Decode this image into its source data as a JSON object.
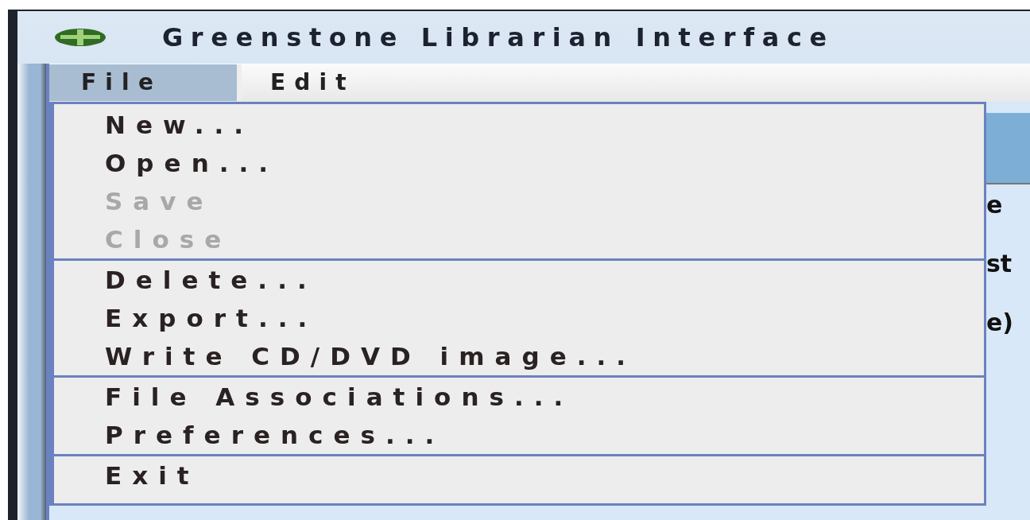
{
  "window": {
    "title": "Greenstone Librarian Interface"
  },
  "menu_bar": [
    {
      "label": "File",
      "selected": true
    },
    {
      "label": "Edit",
      "selected": false
    }
  ],
  "file_menu": [
    {
      "kind": "item",
      "label": "New...",
      "disabled": false
    },
    {
      "kind": "item",
      "label": "Open...",
      "disabled": false
    },
    {
      "kind": "item",
      "label": "Save",
      "disabled": true
    },
    {
      "kind": "item",
      "label": "Close",
      "disabled": true
    },
    {
      "kind": "separator"
    },
    {
      "kind": "item",
      "label": "Delete...",
      "disabled": false
    },
    {
      "kind": "item",
      "label": "Export...",
      "disabled": false
    },
    {
      "kind": "item",
      "label": "Write CD/DVD image...",
      "disabled": false
    },
    {
      "kind": "separator"
    },
    {
      "kind": "item",
      "label": "File Associations...",
      "disabled": false
    },
    {
      "kind": "item",
      "label": "Preferences...",
      "disabled": false
    },
    {
      "kind": "separator"
    },
    {
      "kind": "item",
      "label": "Exit",
      "disabled": false
    }
  ],
  "background_text": [
    "e",
    "st",
    "e)"
  ]
}
